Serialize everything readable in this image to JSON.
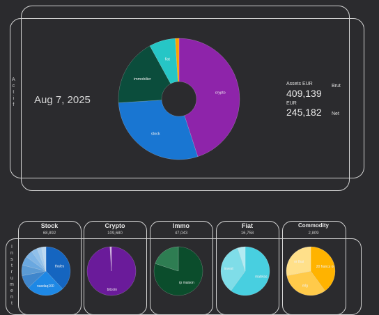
{
  "date": "Aug 7, 2025",
  "actif_label": "Actif",
  "instrument_label": "Instrument",
  "summary": {
    "assets_label": "Assets EUR",
    "assets_value": "409,139",
    "brut_label": "Brut",
    "eur_label": "EUR",
    "net_value": "245,182",
    "net_label": "Net"
  },
  "colors": {
    "crypto": "#8e24aa",
    "stock": "#1976d2",
    "immobilier": "#0b4d3c",
    "fiat": "#26c6c6",
    "commodity": "#ffa000"
  },
  "chart_data": [
    {
      "type": "pie",
      "donut": true,
      "slices": [
        {
          "label": "crypto",
          "value": 45
        },
        {
          "label": "stock",
          "value": 29
        },
        {
          "label": "immobilier",
          "value": 18
        },
        {
          "label": "fiat",
          "value": 7
        },
        {
          "label": "",
          "value": 1
        }
      ]
    },
    {
      "type": "pie",
      "title": "Stock",
      "subtitle": "68,892",
      "slices": [
        {
          "label": "thales",
          "value": 38
        },
        {
          "label": "nasdaq100",
          "value": 25
        },
        {
          "label": "",
          "value": 9
        },
        {
          "label": "",
          "value": 7
        },
        {
          "label": "",
          "value": 6
        },
        {
          "label": "",
          "value": 5
        },
        {
          "label": "",
          "value": 4
        },
        {
          "label": "",
          "value": 3
        },
        {
          "label": "",
          "value": 3
        }
      ]
    },
    {
      "type": "pie",
      "title": "Crypto",
      "subtitle": "109,680",
      "slices": [
        {
          "label": "bitcoin",
          "value": 99
        },
        {
          "label": "",
          "value": 1
        }
      ]
    },
    {
      "type": "pie",
      "title": "Immo",
      "subtitle": "47,043",
      "slices": [
        {
          "label": "rp maison",
          "value": 80
        },
        {
          "label": "",
          "value": 20
        }
      ]
    },
    {
      "type": "pie",
      "title": "Fiat",
      "subtitle": "16,758",
      "slices": [
        {
          "label": "matelas",
          "value": 60
        },
        {
          "label": "invest",
          "value": 35
        },
        {
          "label": "",
          "value": 5
        }
      ]
    },
    {
      "type": "pie",
      "title": "Commodity",
      "subtitle": "2,809",
      "slices": [
        {
          "label": "20 francs or",
          "value": 40
        },
        {
          "label": "mlg",
          "value": 32
        },
        {
          "label": "or thai",
          "value": 28
        }
      ]
    }
  ]
}
